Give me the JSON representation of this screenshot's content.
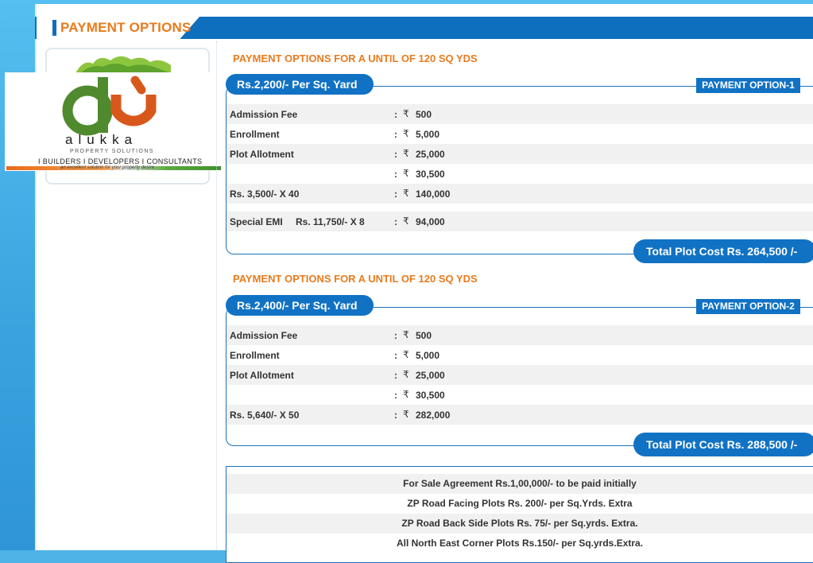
{
  "header": {
    "title": "PAYMENT OPTIONS"
  },
  "logo": {
    "brand": "alukka",
    "subtitle": "PROPERTY SOLUTIONS",
    "tagline": "I BUILDERS I DEVELOPERS I CONSULTANTS",
    "slogan": "an excellent solution for your property desire"
  },
  "currency_symbol": "₹",
  "options": [
    {
      "section_title": "PAYMENT OPTIONS FOR A UNTIL OF 120 SQ YDS",
      "rate": "Rs.2,200/- Per Sq. Yard",
      "label": "PAYMENT OPTION-1",
      "rows": [
        {
          "label": "Admission Fee",
          "amount": "500"
        },
        {
          "label": "Enrollment",
          "amount": "5,000"
        },
        {
          "label": "Plot Allotment",
          "amount": "25,000"
        },
        {
          "label": "",
          "amount": "30,500"
        },
        {
          "label": "Rs. 3,500/- X 40",
          "amount": "140,000"
        },
        {
          "label": "Special EMI",
          "label2": "Rs. 11,750/- X 8",
          "amount": "94,000"
        }
      ],
      "total": "Total Plot Cost Rs. 264,500 /-"
    },
    {
      "section_title": "PAYMENT OPTIONS FOR A UNTIL OF 120 SQ YDS",
      "rate": "Rs.2,400/- Per Sq. Yard",
      "label": "PAYMENT OPTION-2",
      "rows": [
        {
          "label": "Admission Fee",
          "amount": "500"
        },
        {
          "label": "Enrollment",
          "amount": "5,000"
        },
        {
          "label": "Plot Allotment",
          "amount": "25,000"
        },
        {
          "label": "",
          "amount": "30,500"
        },
        {
          "label": "Rs. 5,640/- X 50",
          "amount": "282,000"
        }
      ],
      "total": "Total Plot Cost Rs. 288,500 /-"
    }
  ],
  "notes": [
    "For Sale Agreement Rs.1,00,000/- to be paid initially",
    "ZP Road Facing Plots Rs. 200/- per Sq.Yrds. Extra",
    "ZP Road Back Side Plots Rs. 75/- per Sq.yrds. Extra.",
    "All North East Corner Plots Rs.150/- per Sq.yrds.Extra."
  ],
  "colors": {
    "brand_blue": "#1172c4",
    "accent_orange": "#e87b1e",
    "logo_green": "#4f8a2e"
  }
}
